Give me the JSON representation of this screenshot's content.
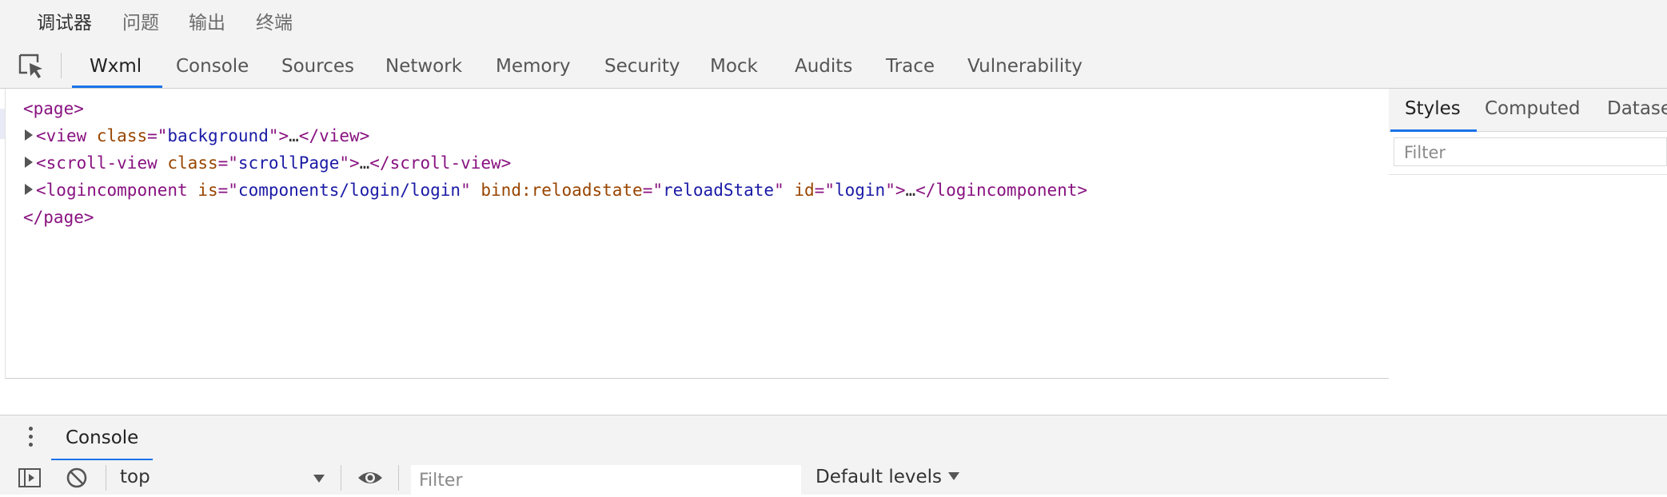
{
  "top_tabs": [
    "调试器",
    "问题",
    "输出",
    "终端"
  ],
  "devtools_tabs": [
    "Wxml",
    "Console",
    "Sources",
    "Network",
    "Memory",
    "Security",
    "Mock",
    "Audits",
    "Trace",
    "Vulnerability"
  ],
  "dom": {
    "page_open": "<page>",
    "page_close": "</page>",
    "nodes": [
      {
        "tag": "view",
        "attrs": [
          {
            "name": "class",
            "value": "background"
          }
        ],
        "close": "</view>"
      },
      {
        "tag": "scroll-view",
        "attrs": [
          {
            "name": "class",
            "value": "scrollPage"
          }
        ],
        "close": "</scroll-view>"
      },
      {
        "tag": "logincomponent",
        "attrs": [
          {
            "name": "is",
            "value": "components/login/login"
          },
          {
            "name": "bind:reloadstate",
            "value": "reloadState"
          },
          {
            "name": "id",
            "value": "login"
          }
        ],
        "close": "</logincomponent>"
      }
    ],
    "ellipsis": "…"
  },
  "styles_panel": {
    "tabs": [
      "Styles",
      "Computed",
      "Dataset"
    ],
    "filter_placeholder": "Filter"
  },
  "drawer": {
    "tab": "Console",
    "context": "top",
    "filter_placeholder": "Filter",
    "levels": "Default levels"
  },
  "colors": {
    "tag": "#881280",
    "attr_name": "#994500",
    "attr_value": "#1a1aa6",
    "accent": "#1a73e8"
  },
  "icons": [
    "inspect-element-icon",
    "kebab-menu-icon",
    "sidebar-toggle-icon",
    "clear-console-icon",
    "dropdown-arrow-icon",
    "eye-icon"
  ]
}
